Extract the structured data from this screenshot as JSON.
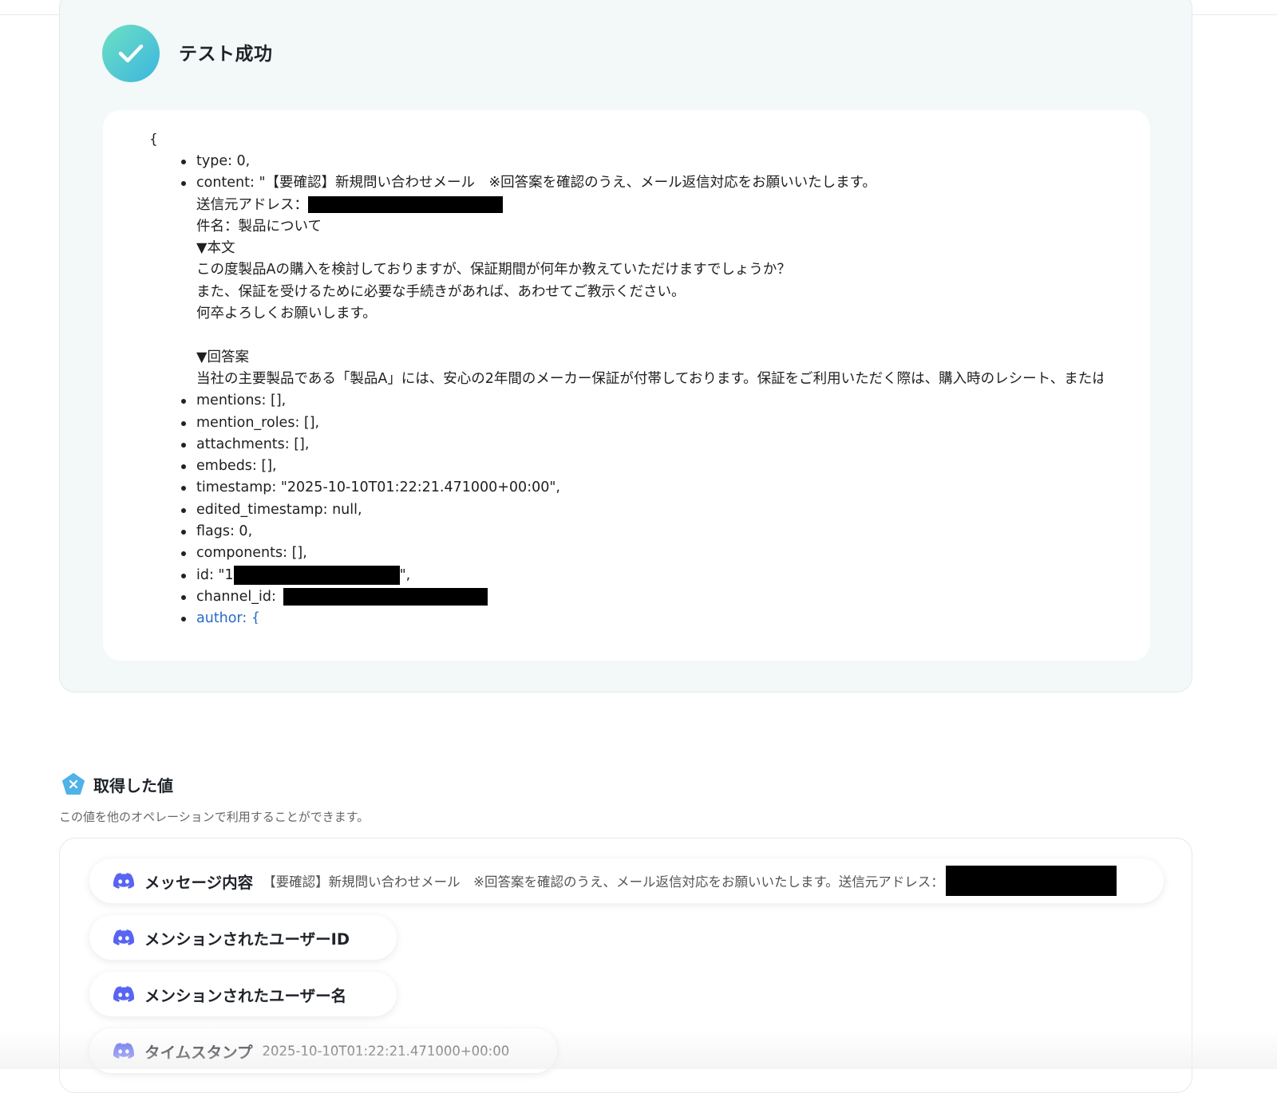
{
  "test_result": {
    "title": "テスト成功",
    "json_open": "{",
    "lines": [
      {
        "kind": "item",
        "text": "type: 0,"
      },
      {
        "kind": "item",
        "text": "content: \"【要確認】新規問い合わせメール　※回答案を確認のうえ、メール返信対応をお願いいたします。"
      },
      {
        "kind": "cont",
        "text": "送信元アドレス："
      },
      {
        "kind": "cont",
        "text": "件名：製品について"
      },
      {
        "kind": "cont",
        "text": "▼本文"
      },
      {
        "kind": "cont",
        "text": "この度製品Aの購入を検討しておりますが、保証期間が何年か教えていただけますでしょうか？"
      },
      {
        "kind": "cont",
        "text": "また、保証を受けるために必要な手続きがあれば、あわせてご教示ください。"
      },
      {
        "kind": "cont",
        "text": "何卒よろしくお願いします。"
      },
      {
        "kind": "blank",
        "text": ""
      },
      {
        "kind": "cont",
        "text": "▼回答案"
      },
      {
        "kind": "cont",
        "text": "当社の主要製品である「製品A」には、安心の2年間のメーカー保証が付帯しております。保証をご利用いただく際は、購入時のレシート、または納"
      },
      {
        "kind": "item",
        "text": "mentions: [],"
      },
      {
        "kind": "item",
        "text": "mention_roles: [],"
      },
      {
        "kind": "item",
        "text": "attachments: [],"
      },
      {
        "kind": "item",
        "text": "embeds: [],"
      },
      {
        "kind": "item",
        "text": "timestamp: \"2025-10-10T01:22:21.471000+00:00\","
      },
      {
        "kind": "item",
        "text": "edited_timestamp: null,"
      },
      {
        "kind": "item",
        "text": "flags: 0,"
      },
      {
        "kind": "item",
        "text": "components: [],"
      },
      {
        "kind": "item",
        "text": "id: \"1"
      },
      {
        "kind": "item",
        "text": "channel_id: "
      },
      {
        "kind": "item",
        "text": "author: {"
      }
    ],
    "id_suffix": "\","
  },
  "acquired_values": {
    "title": "取得した値",
    "description": "この値を他のオペレーションで利用することができます。",
    "items": [
      {
        "label": "メッセージ内容",
        "value": "【要確認】新規問い合わせメール　※回答案を確認のうえ、メール返信対応をお願いいたします。送信元アドレス："
      },
      {
        "label": "メンションされたユーザーID",
        "value": ""
      },
      {
        "label": "メンションされたユーザー名",
        "value": ""
      },
      {
        "label": "タイムスタンプ",
        "value": "2025-10-10T01:22:21.471000+00:00"
      }
    ]
  },
  "colors": {
    "success_gradient_start": "#6ee0c2",
    "success_gradient_end": "#3bb6e0",
    "discord": "#5865F2",
    "panel_bg": "#f3f8f8",
    "pentagon": "#4fb3e8"
  },
  "icons": {
    "success": "check-circle-icon",
    "section": "variable-pentagon-icon",
    "value": "discord-icon"
  }
}
